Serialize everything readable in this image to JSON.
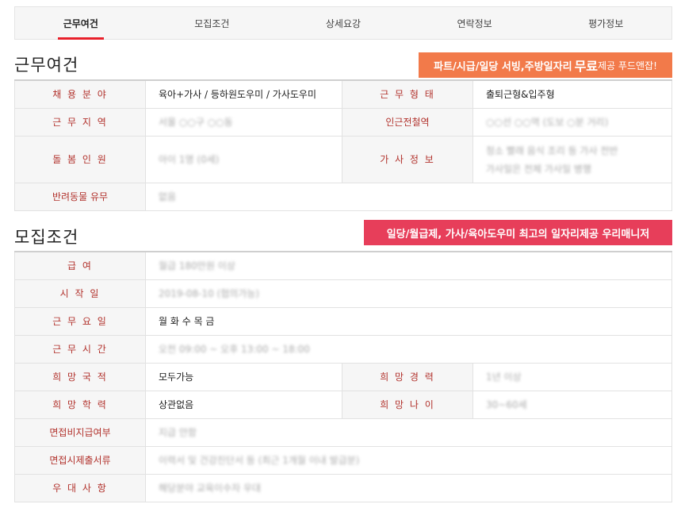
{
  "tabs": [
    "근무여건",
    "모집조건",
    "상세요강",
    "연락정보",
    "평가정보"
  ],
  "section1": {
    "title": "근무여건",
    "banner": {
      "prefix": "파트/시급/일당 서빙,주방일자리 ",
      "highlight": "무료",
      "suffix": "제공 푸드앤잡!"
    },
    "rows": [
      {
        "label1": "채 용 분 야",
        "value1": "육아+가사 / 등하원도우미 / 가사도우미",
        "label2": "근 무 형 태",
        "value2": "출퇴근형&입주형"
      },
      {
        "label1": "근 무 지 역",
        "value1": "서울 ○○구 ○○동",
        "label2": "인근전철역",
        "value2": "○○선 ○○역 (도보 ○분 거리)"
      },
      {
        "label1": "돌 봄 인 원",
        "value1": "아이 1명 (0세)",
        "label2": "가 사 정 보",
        "value2": "청소 빨래 음식 조리 등 가사 전반",
        "value2b": "가사일은 전체 가사일 병행"
      },
      {
        "label1": "반려동물 유무",
        "value1": "없음"
      }
    ]
  },
  "section2": {
    "title": "모집조건",
    "banner": "일당/월급제, 가사/육아도우미 최고의 일자리제공 우리매니저",
    "rows": [
      {
        "label": "급 여",
        "value": "월급 180만원 이상"
      },
      {
        "label": "시 작 일",
        "value": "2019-08-10 (협의가능)"
      },
      {
        "label": "근 무 요 일",
        "value": "월 화 수 목 금"
      },
      {
        "label": "근 무 시 간",
        "value": "오전 09:00 ~ 오후 13:00 ~ 18:00"
      },
      {
        "label": "희 망 국 적",
        "value": "모두가능",
        "label2": "희 망 경 력",
        "value2": "1년 이상"
      },
      {
        "label": "희 망 학 력",
        "value": "상관없음",
        "label2": "희 망 나 이",
        "value2": "30~60세"
      },
      {
        "label": "면접비지급여부",
        "value": "지급 안함"
      },
      {
        "label": "면접시제출서류",
        "value": "이력서 및 건강진단서 등 (최근 1개월 이내 발급분)"
      },
      {
        "label": "우 대 사 항",
        "value": "해당분야 교육이수자 우대"
      }
    ]
  }
}
